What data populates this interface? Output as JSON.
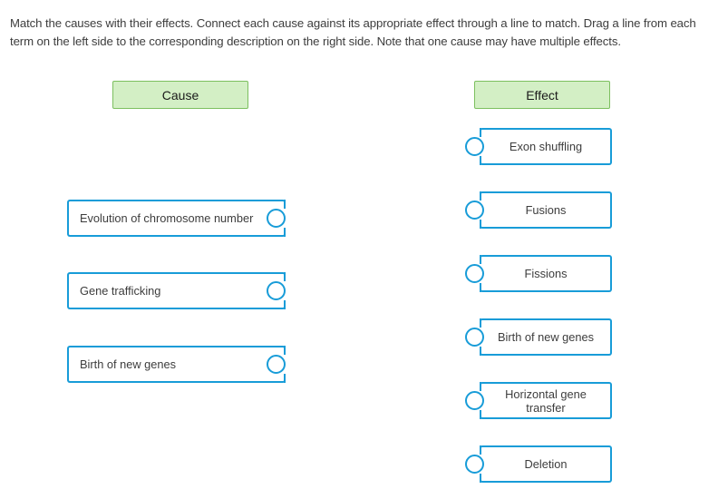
{
  "instructions": "Match the causes with their effects. Connect each cause against its appropriate effect through a line to match. Drag a line from each term on the left side to the corresponding description on the right side. Note that one cause may have multiple effects.",
  "colors": {
    "connector_blue": "#189cd8",
    "header_fill": "#d3efc5",
    "header_border": "#7cbf5f",
    "text": "#3d3d3d"
  },
  "cause_column": {
    "header": "Cause",
    "items": [
      {
        "label": "Evolution of chromosome number"
      },
      {
        "label": "Gene trafficking"
      },
      {
        "label": "Birth of new genes"
      }
    ]
  },
  "effect_column": {
    "header": "Effect",
    "items": [
      {
        "label": "Exon shuffling"
      },
      {
        "label": "Fusions"
      },
      {
        "label": "Fissions"
      },
      {
        "label": "Birth of new genes"
      },
      {
        "label": "Horizontal gene transfer"
      },
      {
        "label": "Deletion"
      }
    ]
  }
}
